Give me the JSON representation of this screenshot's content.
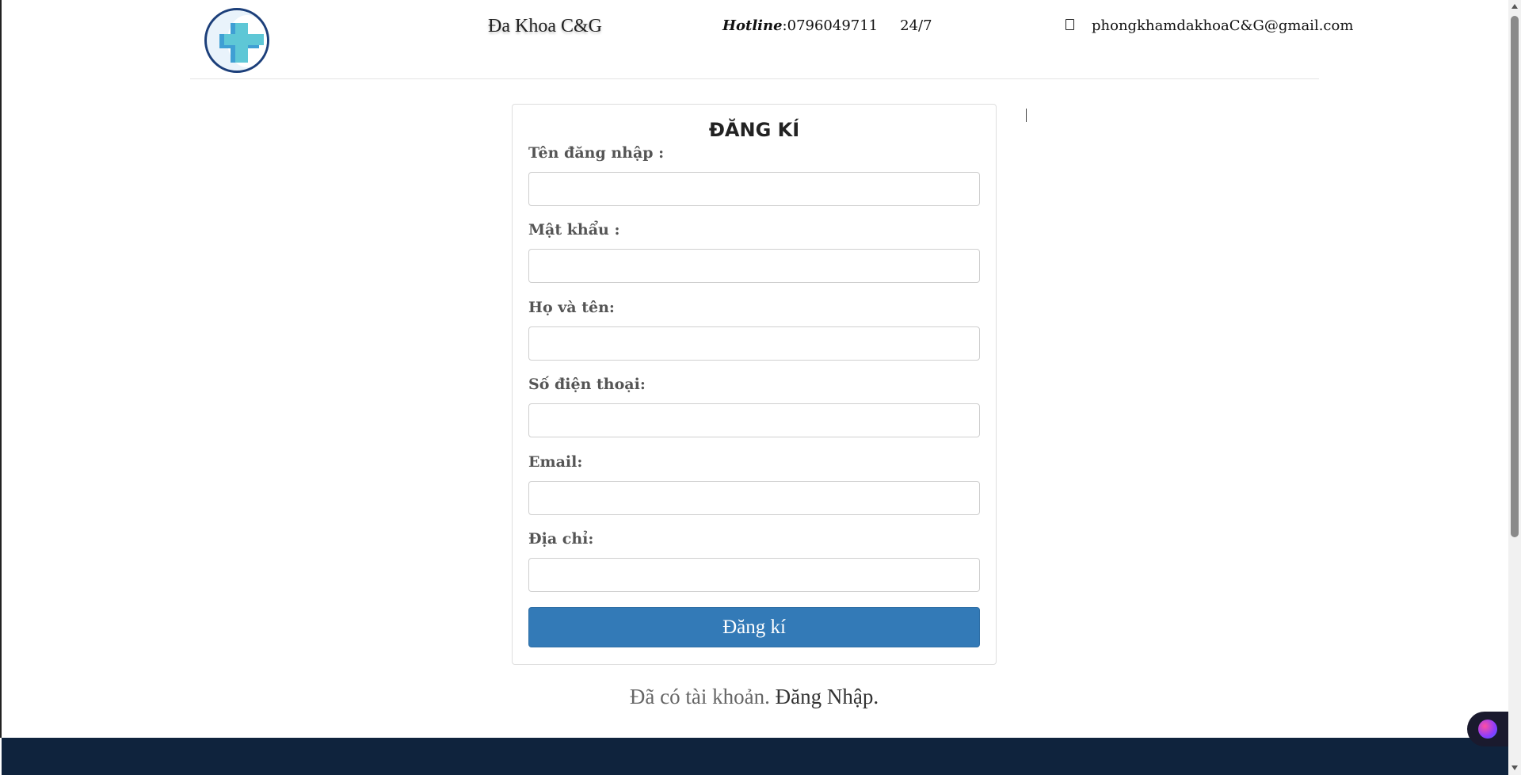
{
  "header": {
    "brand": "Đa Khoa C&G",
    "hotline_label": "Hotline",
    "hotline_number": ":0796049711",
    "hotline_hours": "24/7",
    "email_icon": "envelope-icon",
    "email": "phongkhamdakhoaC&G@gmail.com",
    "logo_icon": "medical-cross-logo"
  },
  "form": {
    "title": "ĐĂNG KÍ",
    "fields": [
      {
        "label": "Tên đăng nhập :",
        "value": ""
      },
      {
        "label": "Mật khẩu :",
        "value": ""
      },
      {
        "label": "Họ và tên:",
        "value": ""
      },
      {
        "label": "Số điện thoại:",
        "value": ""
      },
      {
        "label": "Email:",
        "value": ""
      },
      {
        "label": "Địa chỉ:",
        "value": ""
      }
    ],
    "submit_label": "Đăng kí"
  },
  "login_prompt": {
    "text": "Đã có tài khoản. ",
    "link": "Đăng Nhập."
  },
  "chat_widget_icon": "brain-icon",
  "colors": {
    "primary_button": "#337ab7",
    "footer": "#0f233d",
    "logo_border": "#1c3f7a"
  }
}
